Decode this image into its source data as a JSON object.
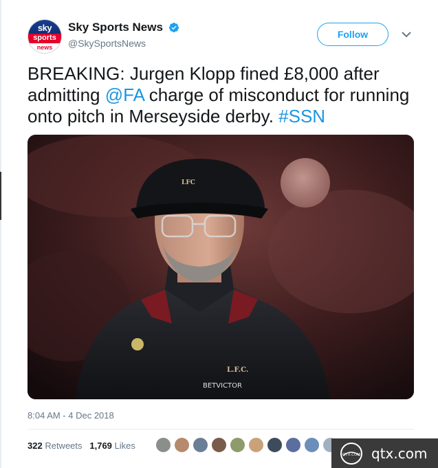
{
  "account": {
    "display_name": "Sky Sports News",
    "handle": "@SkySportsNews",
    "verified": true,
    "avatar_lines": [
      "sky",
      "sports",
      "news"
    ]
  },
  "follow_button_label": "Follow",
  "tweet": {
    "part1": "BREAKING: Jurgen Klopp fined £8,000 after admitting ",
    "mention": "@FA",
    "part2": " charge of misconduct for running onto pitch in Merseyside derby. ",
    "hashtag": "#SSN"
  },
  "photo": {
    "cap_text": "LFC",
    "crest_text": "L.F.C.",
    "sponsor_text": "BETVICTOR"
  },
  "timestamp": "8:04 AM - 4 Dec 2018",
  "stats": {
    "retweets_count": "322",
    "retweets_label": "Retweets",
    "likes_count": "1,769",
    "likes_label": "Likes"
  },
  "liker_avatars": [
    "#8a8f8a",
    "#b58a6d",
    "#6a7f96",
    "#7a5b4a",
    "#8f9b6a",
    "#c9a27a",
    "#3e4b5c",
    "#5a6fa0",
    "#6b8fb8",
    "#a0b0c0"
  ],
  "watermark": {
    "logo_text": "QTX.COM",
    "text": "qtx.com"
  },
  "colors": {
    "link": "#1b95e0",
    "follow": "#1da1f2",
    "sky_blue": "#0e2a6e",
    "sky_red": "#e4002b"
  }
}
